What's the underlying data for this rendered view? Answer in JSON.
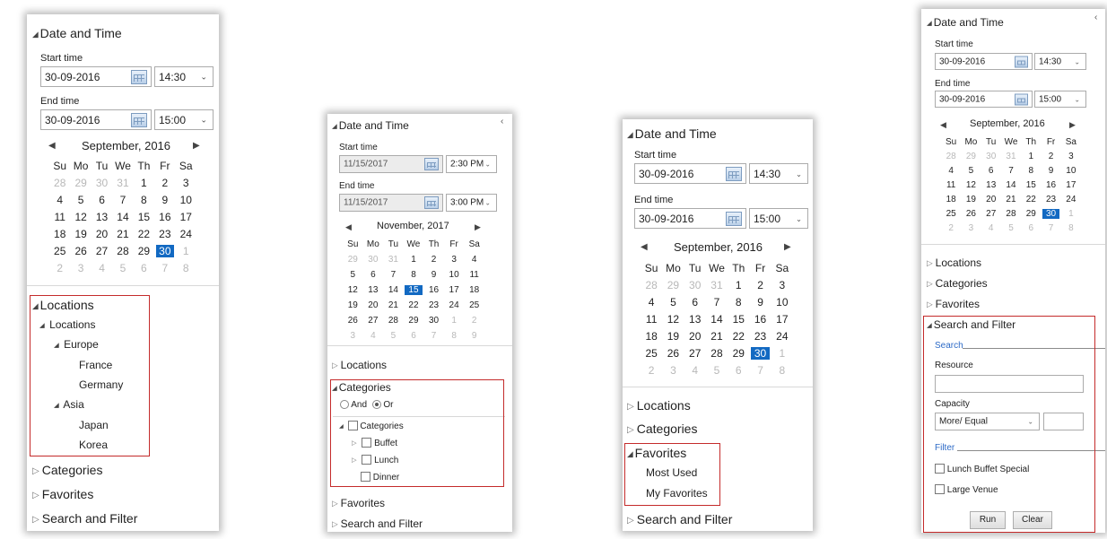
{
  "date_and_time": "Date and Time",
  "start_time": "Start time",
  "end_time": "End time",
  "days": [
    "Su",
    "Mo",
    "Tu",
    "We",
    "Th",
    "Fr",
    "Sa"
  ],
  "sections": {
    "locations": "Locations",
    "categories": "Categories",
    "favorites": "Favorites",
    "search_and_filter": "Search and Filter"
  },
  "icons": {
    "collapse_panel": "chevron-left-icon",
    "calendar": "calendar-icon",
    "dropdown": "chevron-down-icon",
    "expanded": "triangle-down-icon",
    "collapsed": "triangle-right-icon"
  },
  "colors": {
    "selected_day": "#1269c2",
    "highlight_border": "#c42b2b",
    "legend_blue": "#2e6bc7",
    "disabled_field": "#ececec"
  },
  "panel1": {
    "start_date": "30-09-2016",
    "start_time": "14:30",
    "end_date": "30-09-2016",
    "end_time": "15:00",
    "month": "September, 2016",
    "weeks": [
      [
        "28",
        "29",
        "30",
        "31",
        "1",
        "2",
        "3"
      ],
      [
        "4",
        "5",
        "6",
        "7",
        "8",
        "9",
        "10"
      ],
      [
        "11",
        "12",
        "13",
        "14",
        "15",
        "16",
        "17"
      ],
      [
        "18",
        "19",
        "20",
        "21",
        "22",
        "23",
        "24"
      ],
      [
        "25",
        "26",
        "27",
        "28",
        "29",
        "30",
        "1"
      ],
      [
        "2",
        "3",
        "4",
        "5",
        "6",
        "7",
        "8"
      ]
    ],
    "location_tree": {
      "root": "Locations",
      "europe": "Europe",
      "france": "France",
      "germany": "Germany",
      "asia": "Asia",
      "japan": "Japan",
      "korea": "Korea"
    }
  },
  "panel2": {
    "start_date": "11/15/2017",
    "start_time": "2:30 PM",
    "end_date": "11/15/2017",
    "end_time": "3:00 PM",
    "month": "November, 2017",
    "weeks": [
      [
        "29",
        "30",
        "31",
        "1",
        "2",
        "3",
        "4"
      ],
      [
        "5",
        "6",
        "7",
        "8",
        "9",
        "10",
        "11"
      ],
      [
        "12",
        "13",
        "14",
        "15",
        "16",
        "17",
        "18"
      ],
      [
        "19",
        "20",
        "21",
        "22",
        "23",
        "24",
        "25"
      ],
      [
        "26",
        "27",
        "28",
        "29",
        "30",
        "1",
        "2"
      ],
      [
        "3",
        "4",
        "5",
        "6",
        "7",
        "8",
        "9"
      ]
    ],
    "and_label": "And",
    "or_label": "Or",
    "category_tree": {
      "root": "Categories",
      "buffet": "Buffet",
      "lunch": "Lunch",
      "dinner": "Dinner"
    }
  },
  "panel3": {
    "start_date": "30-09-2016",
    "start_time": "14:30",
    "end_date": "30-09-2016",
    "end_time": "15:00",
    "month": "September, 2016",
    "weeks": [
      [
        "28",
        "29",
        "30",
        "31",
        "1",
        "2",
        "3"
      ],
      [
        "4",
        "5",
        "6",
        "7",
        "8",
        "9",
        "10"
      ],
      [
        "11",
        "12",
        "13",
        "14",
        "15",
        "16",
        "17"
      ],
      [
        "18",
        "19",
        "20",
        "21",
        "22",
        "23",
        "24"
      ],
      [
        "25",
        "26",
        "27",
        "28",
        "29",
        "30",
        "1"
      ],
      [
        "2",
        "3",
        "4",
        "5",
        "6",
        "7",
        "8"
      ]
    ],
    "favorites": {
      "most_used": "Most Used",
      "my_favorites": "My Favorites"
    }
  },
  "panel4": {
    "start_date": "30-09-2016",
    "start_time": "14:30",
    "end_date": "30-09-2016",
    "end_time": "15:00",
    "month": "September, 2016",
    "weeks": [
      [
        "28",
        "29",
        "30",
        "31",
        "1",
        "2",
        "3"
      ],
      [
        "4",
        "5",
        "6",
        "7",
        "8",
        "9",
        "10"
      ],
      [
        "11",
        "12",
        "13",
        "14",
        "15",
        "16",
        "17"
      ],
      [
        "18",
        "19",
        "20",
        "21",
        "22",
        "23",
        "24"
      ],
      [
        "25",
        "26",
        "27",
        "28",
        "29",
        "30",
        "1"
      ],
      [
        "2",
        "3",
        "4",
        "5",
        "6",
        "7",
        "8"
      ]
    ],
    "search_legend": "Search",
    "resource_label": "Resource",
    "resource_value": "",
    "capacity_label": "Capacity",
    "capacity_operator": "More/ Equal",
    "capacity_value": "",
    "filter_legend": "Filter",
    "filter_lunch_buffet": "Lunch Buffet Special",
    "filter_large_venue": "Large Venue",
    "run_button": "Run",
    "clear_button": "Clear"
  }
}
